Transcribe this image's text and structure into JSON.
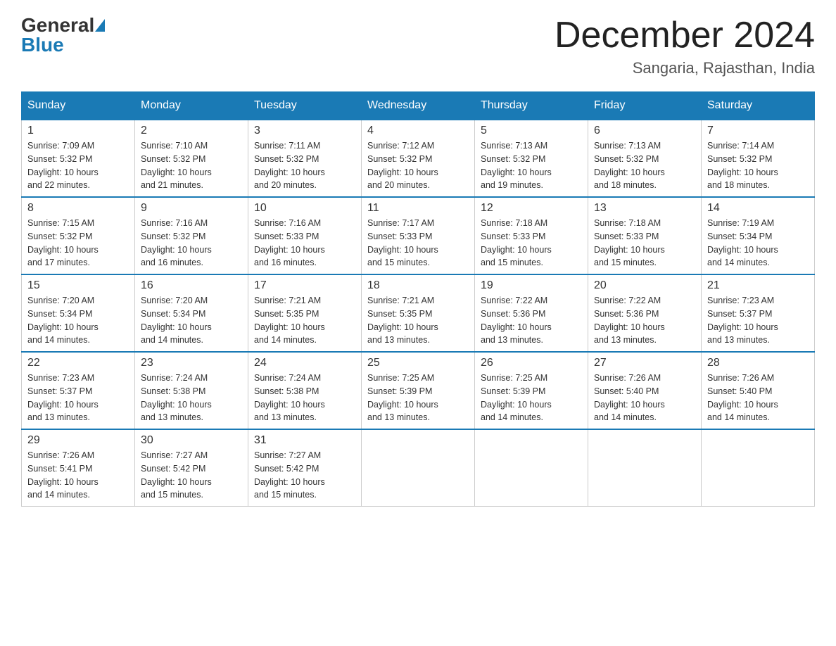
{
  "header": {
    "logo_general": "General",
    "logo_blue": "Blue",
    "month_title": "December 2024",
    "location": "Sangaria, Rajasthan, India"
  },
  "days_of_week": [
    "Sunday",
    "Monday",
    "Tuesday",
    "Wednesday",
    "Thursday",
    "Friday",
    "Saturday"
  ],
  "weeks": [
    [
      {
        "day": "1",
        "sunrise": "7:09 AM",
        "sunset": "5:32 PM",
        "daylight": "10 hours and 22 minutes."
      },
      {
        "day": "2",
        "sunrise": "7:10 AM",
        "sunset": "5:32 PM",
        "daylight": "10 hours and 21 minutes."
      },
      {
        "day": "3",
        "sunrise": "7:11 AM",
        "sunset": "5:32 PM",
        "daylight": "10 hours and 20 minutes."
      },
      {
        "day": "4",
        "sunrise": "7:12 AM",
        "sunset": "5:32 PM",
        "daylight": "10 hours and 20 minutes."
      },
      {
        "day": "5",
        "sunrise": "7:13 AM",
        "sunset": "5:32 PM",
        "daylight": "10 hours and 19 minutes."
      },
      {
        "day": "6",
        "sunrise": "7:13 AM",
        "sunset": "5:32 PM",
        "daylight": "10 hours and 18 minutes."
      },
      {
        "day": "7",
        "sunrise": "7:14 AM",
        "sunset": "5:32 PM",
        "daylight": "10 hours and 18 minutes."
      }
    ],
    [
      {
        "day": "8",
        "sunrise": "7:15 AM",
        "sunset": "5:32 PM",
        "daylight": "10 hours and 17 minutes."
      },
      {
        "day": "9",
        "sunrise": "7:16 AM",
        "sunset": "5:32 PM",
        "daylight": "10 hours and 16 minutes."
      },
      {
        "day": "10",
        "sunrise": "7:16 AM",
        "sunset": "5:33 PM",
        "daylight": "10 hours and 16 minutes."
      },
      {
        "day": "11",
        "sunrise": "7:17 AM",
        "sunset": "5:33 PM",
        "daylight": "10 hours and 15 minutes."
      },
      {
        "day": "12",
        "sunrise": "7:18 AM",
        "sunset": "5:33 PM",
        "daylight": "10 hours and 15 minutes."
      },
      {
        "day": "13",
        "sunrise": "7:18 AM",
        "sunset": "5:33 PM",
        "daylight": "10 hours and 15 minutes."
      },
      {
        "day": "14",
        "sunrise": "7:19 AM",
        "sunset": "5:34 PM",
        "daylight": "10 hours and 14 minutes."
      }
    ],
    [
      {
        "day": "15",
        "sunrise": "7:20 AM",
        "sunset": "5:34 PM",
        "daylight": "10 hours and 14 minutes."
      },
      {
        "day": "16",
        "sunrise": "7:20 AM",
        "sunset": "5:34 PM",
        "daylight": "10 hours and 14 minutes."
      },
      {
        "day": "17",
        "sunrise": "7:21 AM",
        "sunset": "5:35 PM",
        "daylight": "10 hours and 14 minutes."
      },
      {
        "day": "18",
        "sunrise": "7:21 AM",
        "sunset": "5:35 PM",
        "daylight": "10 hours and 13 minutes."
      },
      {
        "day": "19",
        "sunrise": "7:22 AM",
        "sunset": "5:36 PM",
        "daylight": "10 hours and 13 minutes."
      },
      {
        "day": "20",
        "sunrise": "7:22 AM",
        "sunset": "5:36 PM",
        "daylight": "10 hours and 13 minutes."
      },
      {
        "day": "21",
        "sunrise": "7:23 AM",
        "sunset": "5:37 PM",
        "daylight": "10 hours and 13 minutes."
      }
    ],
    [
      {
        "day": "22",
        "sunrise": "7:23 AM",
        "sunset": "5:37 PM",
        "daylight": "10 hours and 13 minutes."
      },
      {
        "day": "23",
        "sunrise": "7:24 AM",
        "sunset": "5:38 PM",
        "daylight": "10 hours and 13 minutes."
      },
      {
        "day": "24",
        "sunrise": "7:24 AM",
        "sunset": "5:38 PM",
        "daylight": "10 hours and 13 minutes."
      },
      {
        "day": "25",
        "sunrise": "7:25 AM",
        "sunset": "5:39 PM",
        "daylight": "10 hours and 13 minutes."
      },
      {
        "day": "26",
        "sunrise": "7:25 AM",
        "sunset": "5:39 PM",
        "daylight": "10 hours and 14 minutes."
      },
      {
        "day": "27",
        "sunrise": "7:26 AM",
        "sunset": "5:40 PM",
        "daylight": "10 hours and 14 minutes."
      },
      {
        "day": "28",
        "sunrise": "7:26 AM",
        "sunset": "5:40 PM",
        "daylight": "10 hours and 14 minutes."
      }
    ],
    [
      {
        "day": "29",
        "sunrise": "7:26 AM",
        "sunset": "5:41 PM",
        "daylight": "10 hours and 14 minutes."
      },
      {
        "day": "30",
        "sunrise": "7:27 AM",
        "sunset": "5:42 PM",
        "daylight": "10 hours and 15 minutes."
      },
      {
        "day": "31",
        "sunrise": "7:27 AM",
        "sunset": "5:42 PM",
        "daylight": "10 hours and 15 minutes."
      },
      null,
      null,
      null,
      null
    ]
  ],
  "labels": {
    "sunrise": "Sunrise:",
    "sunset": "Sunset:",
    "daylight": "Daylight:"
  }
}
